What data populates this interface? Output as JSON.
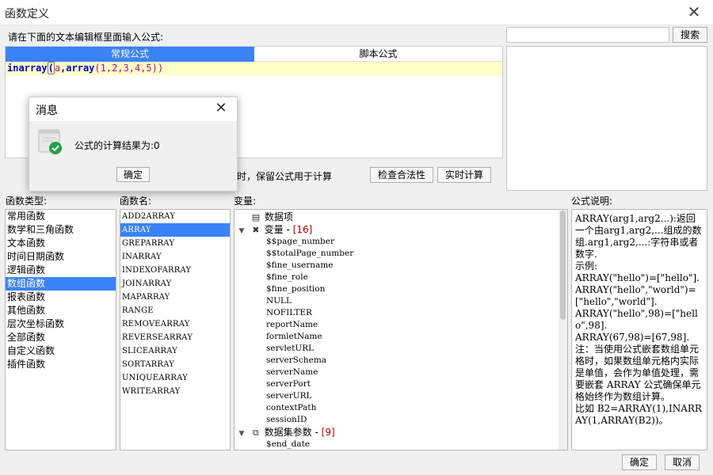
{
  "window": {
    "title": "函数定义"
  },
  "editor": {
    "prompt": "请在下面的文本编辑框里面输入公式:",
    "tabs": [
      "常规公式",
      "脚本公式"
    ],
    "active_tab": "常规公式",
    "formula_parts": {
      "fn1": "inarray",
      "p1": "(",
      "arg1": "a",
      "comma": ",",
      "fn2": "array",
      "p2": "(1,2,3,4,5))"
    },
    "keep_formula_text": "时，保留公式用于计算",
    "check_button": "检查合法性",
    "calc_button": "实时计算"
  },
  "search": {
    "value": "",
    "button": "搜索"
  },
  "sections": {
    "type_label": "函数类型:",
    "name_label": "函数名:",
    "var_label": "变量:",
    "desc_label": "公式说明:"
  },
  "function_types": [
    "常用函数",
    "数学和三角函数",
    "文本函数",
    "时间日期函数",
    "逻辑函数",
    "数组函数",
    "报表函数",
    "其他函数",
    "层次坐标函数",
    "全部函数",
    "自定义函数",
    "插件函数"
  ],
  "selected_type": "数组函数",
  "function_names": [
    "ADD2ARRAY",
    "ARRAY",
    "GREPARRAY",
    "INARRAY",
    "INDEXOFARRAY",
    "JOINARRAY",
    "MAPARRAY",
    "RANGE",
    "REMOVEARRAY",
    "REVERSEARRAY",
    "SLICEARRAY",
    "SORTARRAY",
    "UNIQUEARRAY",
    "WRITEARRAY"
  ],
  "selected_name": "ARRAY",
  "variables": {
    "data_item": "数据项",
    "var_group": "变量",
    "var_count": "[16]",
    "items": [
      "$$page_number",
      "$$totalPage_number",
      "$fine_username",
      "$fine_role",
      "$fine_position",
      "NULL",
      "NOFILTER",
      "reportName",
      "formletName",
      "servletURL",
      "serverSchema",
      "serverName",
      "serverPort",
      "serverURL",
      "contextPath",
      "sessionID"
    ],
    "dataset_group": "数据集参数",
    "dataset_count": "[9]",
    "dataset_items": [
      "$end_date"
    ]
  },
  "description": "ARRAY(arg1,arg2...):返回一个由arg1,arg2,...组成的数组.arg1,arg2,...:字符串或者数字.\n示例:\nARRAY(\"hello\")=[\"hello\"].\nARRAY(\"hello\",\"world\")=[\"hello\",\"world\"].\nARRAY(\"hello\",98)=[\"hello\",98].\nARRAY(67,98)=[67,98].\n注：当使用公式嵌套数组单元格时，如果数组单元格内实际是单值，会作为单值处理，需要嵌套 ARRAY 公式确保单元格始终作为数组计算。\n比如 B2=ARRAY(1),INARRAY(1,ARRAY(B2))。",
  "footer": {
    "ok": "确定",
    "cancel": "取消"
  },
  "dialog": {
    "title": "消息",
    "message": "公式的计算结果为:0",
    "ok": "确定"
  },
  "colors": {
    "accent": "#3b82f6",
    "success": "#22a04a",
    "code_bg": "#ffffc8"
  },
  "icons": {
    "close": "close-icon",
    "success": "check-circle-icon"
  }
}
